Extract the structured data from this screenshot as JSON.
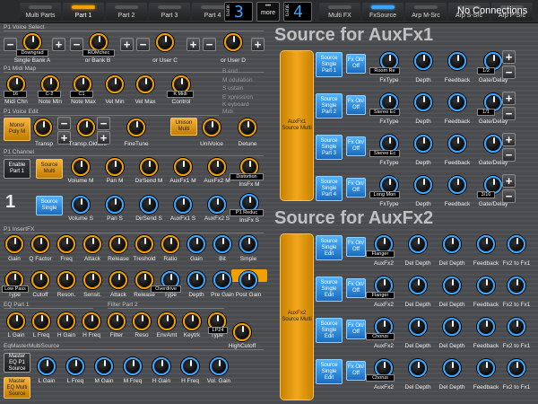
{
  "topbar": {
    "tabs_left": [
      {
        "label": "Multi Parts",
        "active": false
      },
      {
        "label": "Part 1",
        "active": true
      },
      {
        "label": "Part 2",
        "active": false
      },
      {
        "label": "Part 3",
        "active": false
      },
      {
        "label": "Part 4",
        "active": false
      }
    ],
    "bank_left": {
      "label": "bank",
      "value": "3"
    },
    "more": "more",
    "bank_right": {
      "label": "bank",
      "value": "4"
    },
    "tabs_right": [
      {
        "label": "Multi FX",
        "active": false
      },
      {
        "label": "FxSource",
        "active": true
      },
      {
        "label": "Arp M-Src",
        "active": false
      },
      {
        "label": "Arp S-Src",
        "active": false
      },
      {
        "label": "Arp P-Src",
        "active": false
      }
    ],
    "status": "No Connections"
  },
  "left": {
    "voice_select": {
      "header": "P1 Voice Select",
      "items": [
        {
          "label": "Single Bank A",
          "value": "Downgrad"
        },
        {
          "label": "or Bank B",
          "value": "ROMchec"
        },
        {
          "label": "or User C",
          "value": ""
        },
        {
          "label": "or User D",
          "value": ""
        }
      ]
    },
    "midi_map": {
      "header": "P1 Midi Map",
      "items": [
        {
          "label": "Midi Chn",
          "value": "16"
        },
        {
          "label": "Note Min",
          "value": "C-2"
        },
        {
          "label": "Note Max",
          "value": "C1"
        },
        {
          "label": "Vel Min",
          "value": ""
        },
        {
          "label": "Vel Max",
          "value": ""
        },
        {
          "label": "Control",
          "value": "K Midi"
        }
      ],
      "legend": [
        "B end",
        "M odulation",
        "S ustain",
        "",
        "E xpression",
        "K eyboard",
        "Midi"
      ]
    },
    "voice_edit": {
      "header": "P1 Voice Edit",
      "mono_poly": "Mono/ Poly M",
      "unison": "Unison Multi",
      "items": [
        {
          "label": "Transp"
        },
        {
          "label": "Transp.Oktave"
        },
        {
          "label": "FineTune"
        },
        {
          "label": "UniVoice"
        },
        {
          "label": "Detune"
        }
      ]
    },
    "channel": {
      "header": "P1 Channel",
      "enable": "Enable Part 1",
      "source_multi": "Source Multi",
      "source_single": "Source Single",
      "part_number": "1",
      "row1": [
        {
          "label": "Volume M"
        },
        {
          "label": "Pan M"
        },
        {
          "label": "DirSend M"
        },
        {
          "label": "AuxFx1 M"
        },
        {
          "label": "AuxFx2 M"
        },
        {
          "label": "InsFx M",
          "value": "Distortion"
        }
      ],
      "row2": [
        {
          "label": "Volume S"
        },
        {
          "label": "Pan S"
        },
        {
          "label": "DirSend S"
        },
        {
          "label": "AuxFx1 S"
        },
        {
          "label": "AuxFx2 S"
        },
        {
          "label": "InsFx S",
          "value": "P1 Reduc"
        }
      ]
    },
    "insert_fx": {
      "header": "P1 InsertFX",
      "row1": [
        "Gain",
        "Q Factor",
        "Freq",
        "Attack",
        "Release",
        "Treshold",
        "Ratio",
        "Gain",
        "Bit",
        "Smple"
      ],
      "row2": [
        "Type",
        "Cutoff",
        "Reson.",
        "Sensit.",
        "Attack",
        "Release",
        "Type",
        "Depth",
        "Pre Gain",
        "Post Gain"
      ],
      "row2_values": {
        "first": "Low Pass",
        "seventh": "Overdrive"
      }
    },
    "eq": {
      "header1": "EQ Part 1",
      "header2": "Filter Part 2",
      "row": [
        "L Gain",
        "L Freq",
        "H Gain",
        "H Freq",
        "Filter",
        "Reso",
        "EnvAmt",
        "Keytrk",
        "Type",
        "HighCutoff"
      ],
      "type_value": "LP24"
    },
    "eq_master": {
      "header": "EqMasterMultiSource",
      "master_p1": "Master EQ P1 Source",
      "master_multi": "Master EQ Multi Source",
      "row": [
        "L Gain",
        "L Freq",
        "M Gain",
        "M Freq",
        "H Gain",
        "H Freq",
        "Vol. Gain"
      ]
    }
  },
  "right": {
    "aux1": {
      "title": "Source for AuxFx1",
      "source_bar": "AuxFx1 Source Multi",
      "rows": [
        {
          "button": "Source Single Part 1",
          "fx": "Fx On/ Off",
          "fxtype": "Room Re",
          "gate": "1/2"
        },
        {
          "button": "Source Single Part 2",
          "fx": "Fx On/ Off",
          "fxtype": "Stereo Ec",
          "gate": "1/1"
        },
        {
          "button": "Source Single Part 3",
          "fx": "Fx On/ Off",
          "fxtype": "Stereo Ec",
          "gate": ""
        },
        {
          "button": "Source Single Part 4",
          "fx": "Fx On/ Off",
          "fxtype": "Long Mon",
          "gate": "3/16"
        }
      ],
      "labels": [
        "FxType",
        "Depth",
        "Feedback",
        "Gate/Delay"
      ]
    },
    "aux2": {
      "title": "Source for AuxFx2",
      "source_bar": "AuxFx2 Source Multi",
      "rows": [
        {
          "button": "Source Single Edit",
          "fx": "Fx On/ Off",
          "fxtype": "Flanger"
        },
        {
          "button": "Source Single Edit",
          "fx": "Fx On/ Off",
          "fxtype": "Flanger"
        },
        {
          "button": "Source Single Edit",
          "fx": "Fx On/ Off",
          "fxtype": "Chorus"
        },
        {
          "button": "Source Single Edit",
          "fx": "Fx On/ Off",
          "fxtype": "Chorus"
        }
      ],
      "labels": [
        "AuxFx2",
        "Del Depth",
        "Del Depth",
        "Feedback",
        "Fx2 to Fx1"
      ]
    }
  }
}
